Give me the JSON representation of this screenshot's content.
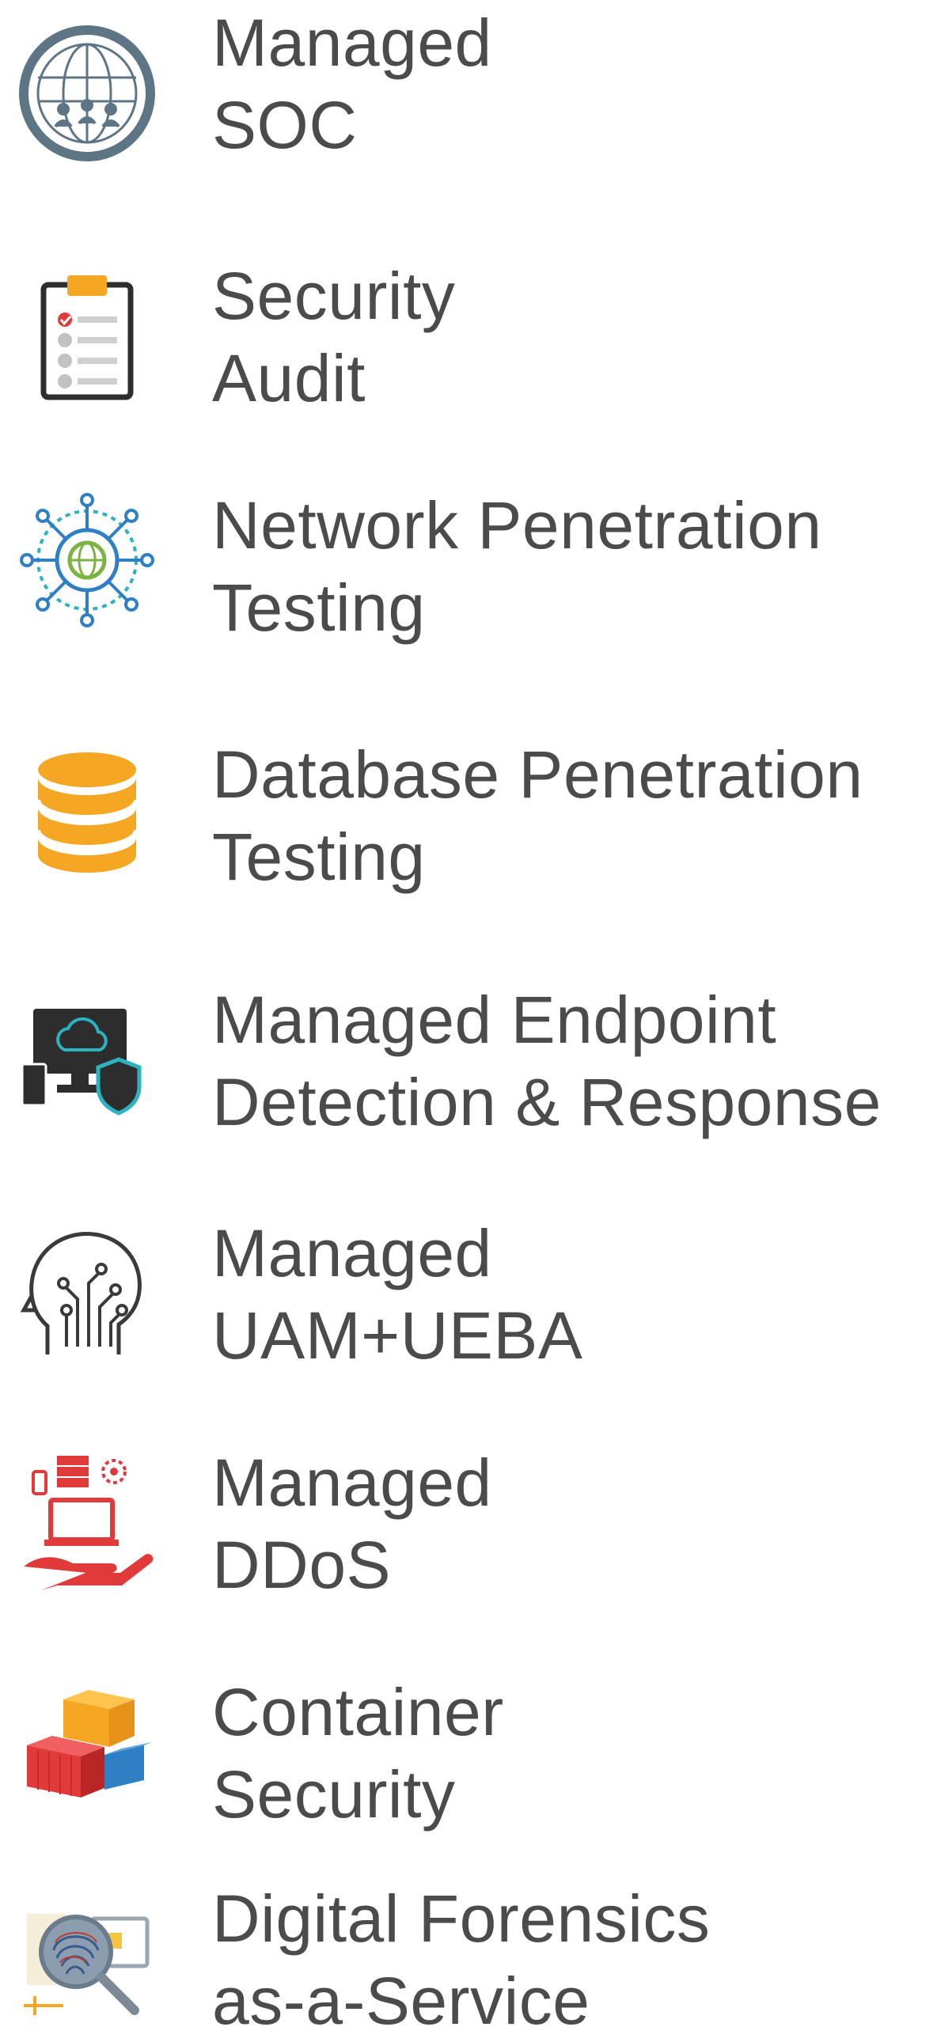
{
  "services": [
    {
      "line1": "Managed",
      "line2": "SOC",
      "icon": "globe-network-icon"
    },
    {
      "line1": "Security",
      "line2": "Audit",
      "icon": "clipboard-checklist-icon"
    },
    {
      "line1": "Network Penetration",
      "line2": "Testing",
      "icon": "network-globe-icon"
    },
    {
      "line1": "Database Penetration",
      "line2": "Testing",
      "icon": "database-icon"
    },
    {
      "line1": "Managed Endpoint",
      "line2": "Detection & Response",
      "icon": "endpoint-devices-shield-icon"
    },
    {
      "line1": "Managed",
      "line2": "UAM+UEBA",
      "icon": "head-circuit-icon"
    },
    {
      "line1": "Managed",
      "line2": "DDoS",
      "icon": "hand-laptop-server-icon"
    },
    {
      "line1": "Container",
      "line2": "Security",
      "icon": "shipping-containers-icon"
    },
    {
      "line1": "Digital Forensics",
      "line2": "as-a-Service",
      "icon": "fingerprint-magnifier-icon"
    }
  ],
  "colors": {
    "text": "#4b4b4b",
    "slate": "#5d7585",
    "orange": "#f5a623",
    "red": "#e03a3a",
    "blue": "#2f7fc4",
    "teal": "#2bb3c0",
    "green": "#7cb342",
    "dark": "#2d2d2d"
  }
}
